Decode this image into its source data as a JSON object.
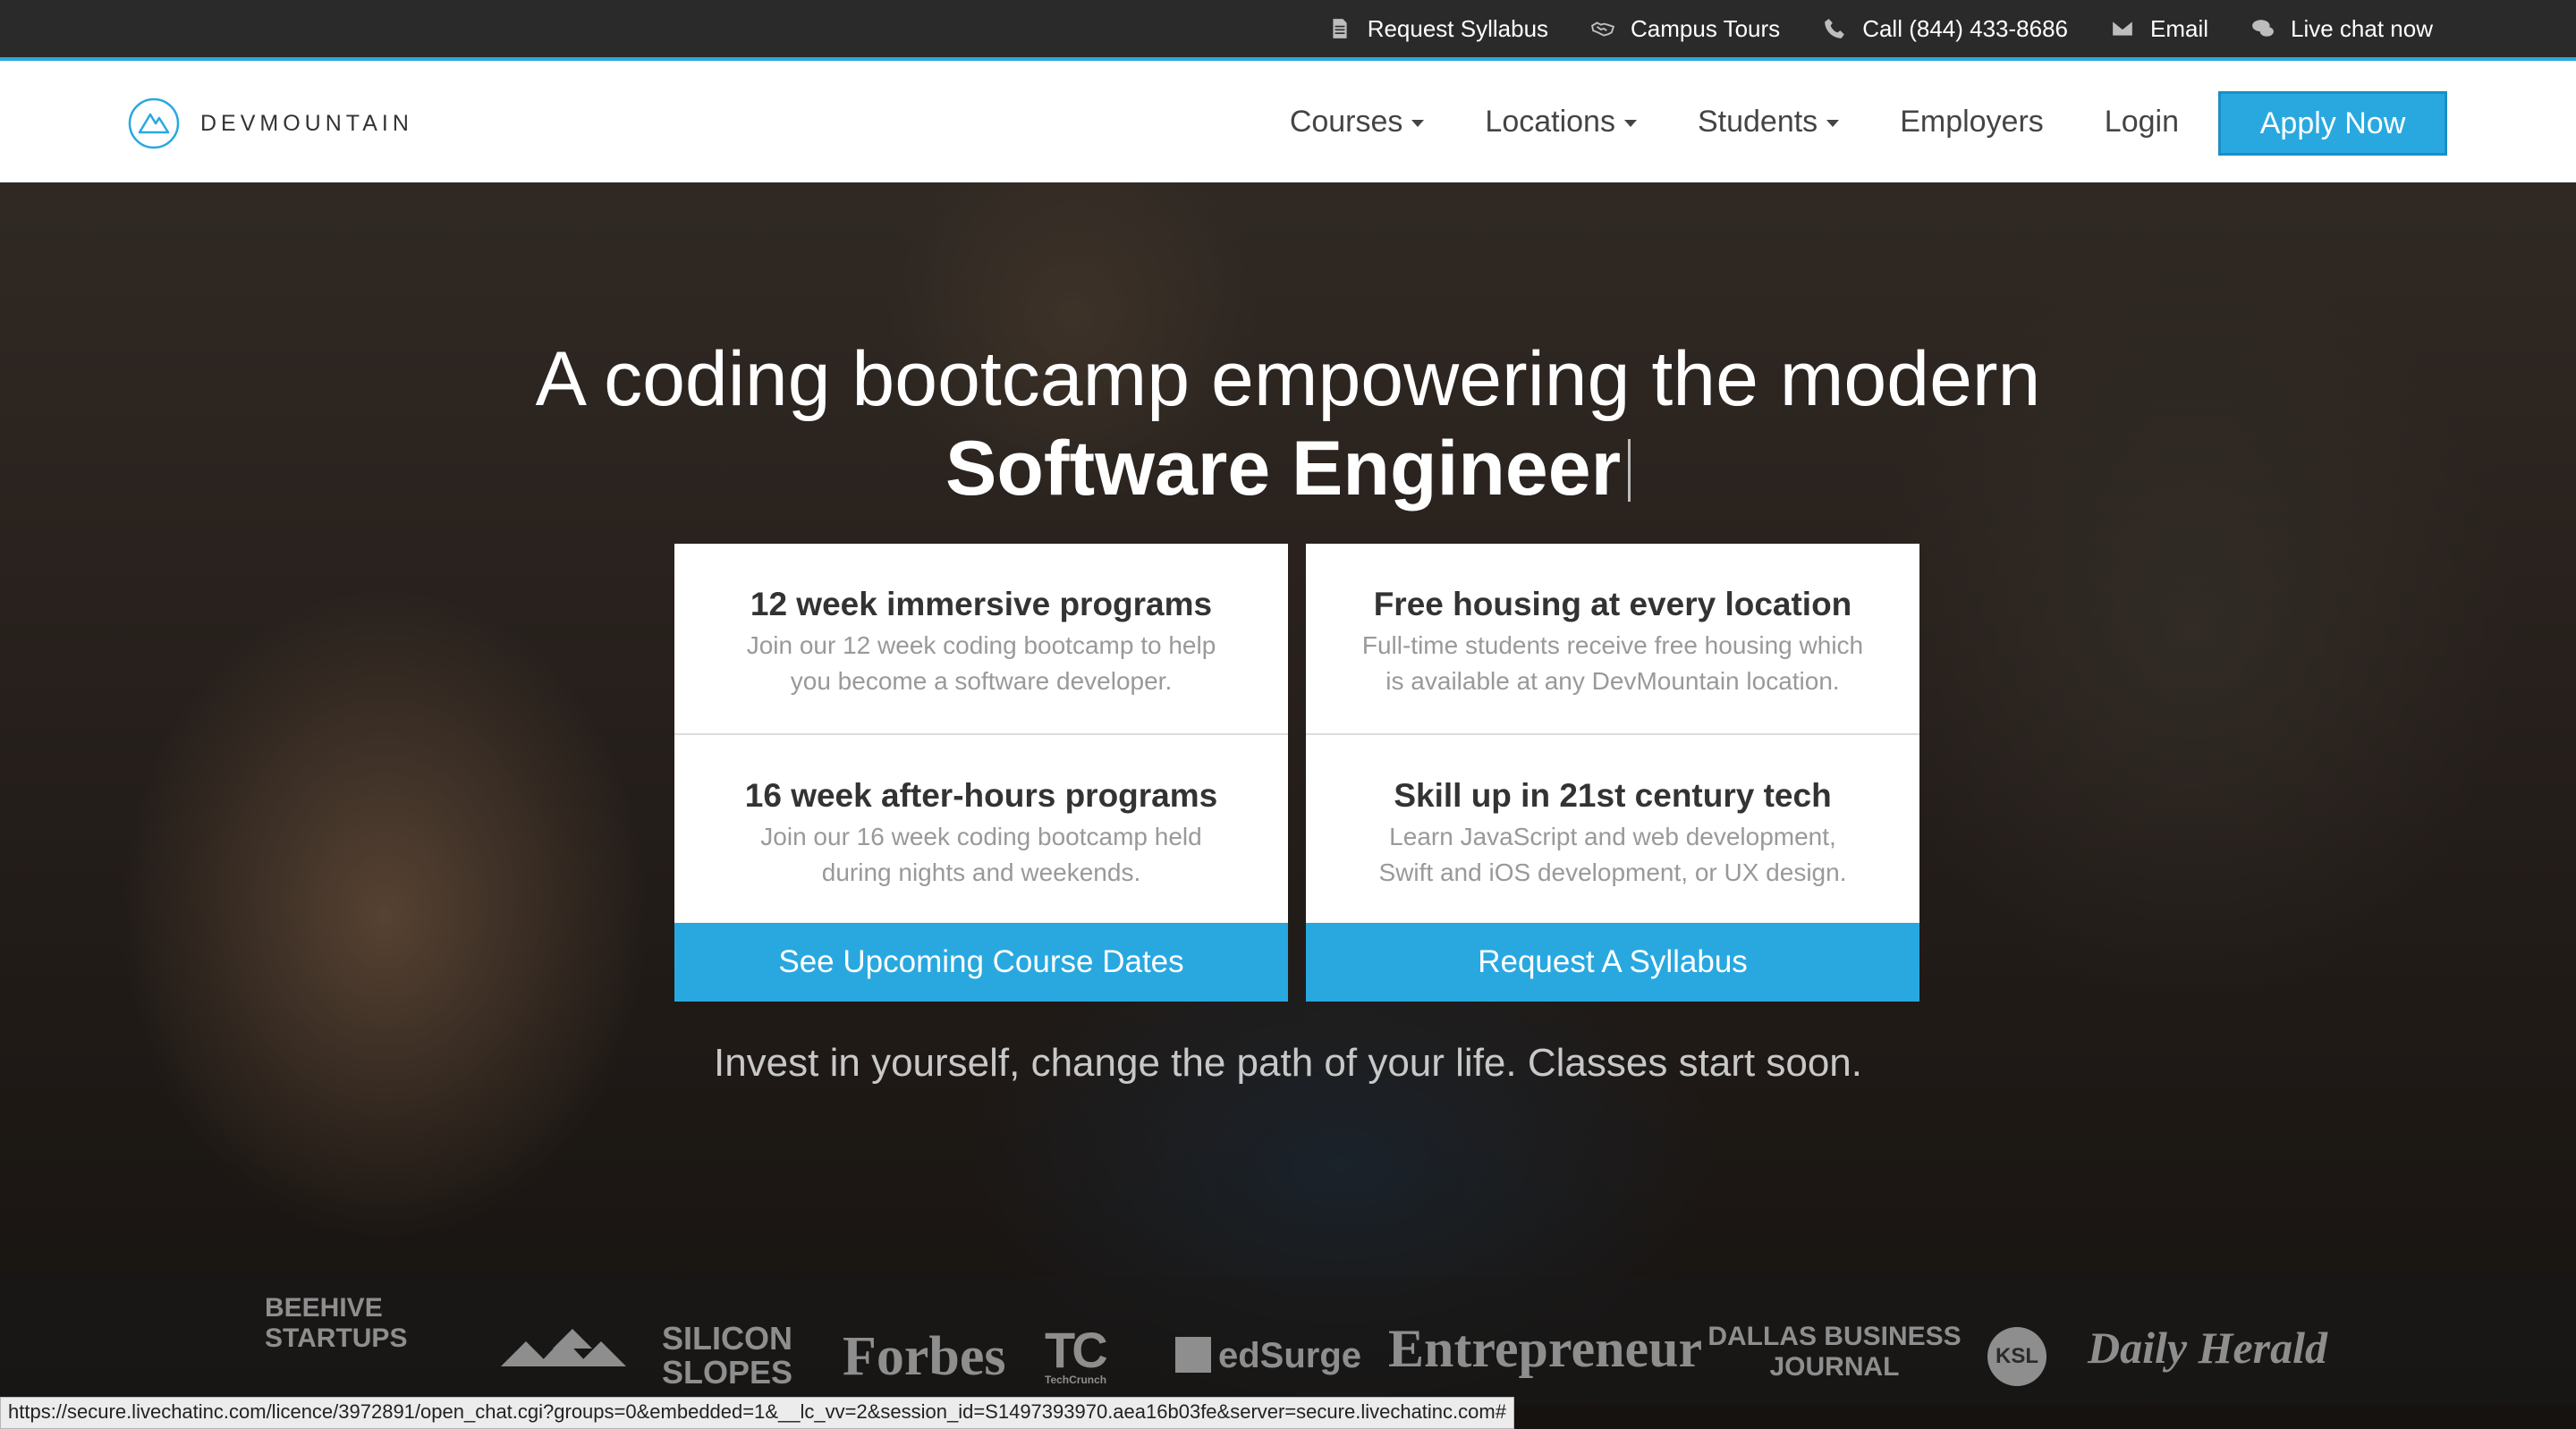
{
  "topbar": {
    "links": [
      {
        "label": "Request Syllabus",
        "icon": "document-icon"
      },
      {
        "label": "Campus Tours",
        "icon": "handshake-icon"
      },
      {
        "label": "Call (844) 433-8686",
        "icon": "phone-icon"
      },
      {
        "label": "Email",
        "icon": "envelope-icon"
      },
      {
        "label": "Live chat now",
        "icon": "chat-bubbles-icon"
      }
    ]
  },
  "nav": {
    "logo_text": "DEVMOUNTAIN",
    "items": [
      {
        "label": "Courses",
        "dropdown": true
      },
      {
        "label": "Locations",
        "dropdown": true
      },
      {
        "label": "Students",
        "dropdown": true
      },
      {
        "label": "Employers",
        "dropdown": false
      },
      {
        "label": "Login",
        "dropdown": false
      }
    ],
    "apply_label": "Apply Now"
  },
  "hero": {
    "headline_line1": "A coding bootcamp empowering the modern",
    "headline_line2": "Software Engineer",
    "cards": [
      {
        "title": "12 week immersive programs",
        "desc": "Join our 12 week coding bootcamp to help you become a software developer."
      },
      {
        "title": "16 week after-hours programs",
        "desc": "Join our 16 week coding bootcamp held during nights and weekends."
      },
      {
        "title": "Free housing at every location",
        "desc": "Full-time students receive free housing which is available at any DevMountain location."
      },
      {
        "title": "Skill up in 21st century tech",
        "desc": "Learn JavaScript and web development, Swift and iOS development, or UX design."
      }
    ],
    "btn_left": "See Upcoming Course Dates",
    "btn_right": "Request A Syllabus",
    "tagline": "Invest in yourself, change the path of your life. Classes start soon."
  },
  "press": {
    "logos": [
      "BEEHIVE STARTUPS",
      "SILICON SLOPES",
      "Forbes",
      "TechCrunch",
      "edSurge",
      "Entrepreneur",
      "DALLAS BUSINESS JOURNAL",
      "KSL",
      "Daily Herald"
    ]
  },
  "status_url": "https://secure.livechatinc.com/licence/3972891/open_chat.cgi?groups=0&embedded=1&__lc_vv=2&session_id=S1497393970.aea16b03fe&server=secure.livechatinc.com#",
  "colors": {
    "accent": "#29a8e0",
    "topbar": "#2a2a2a"
  }
}
